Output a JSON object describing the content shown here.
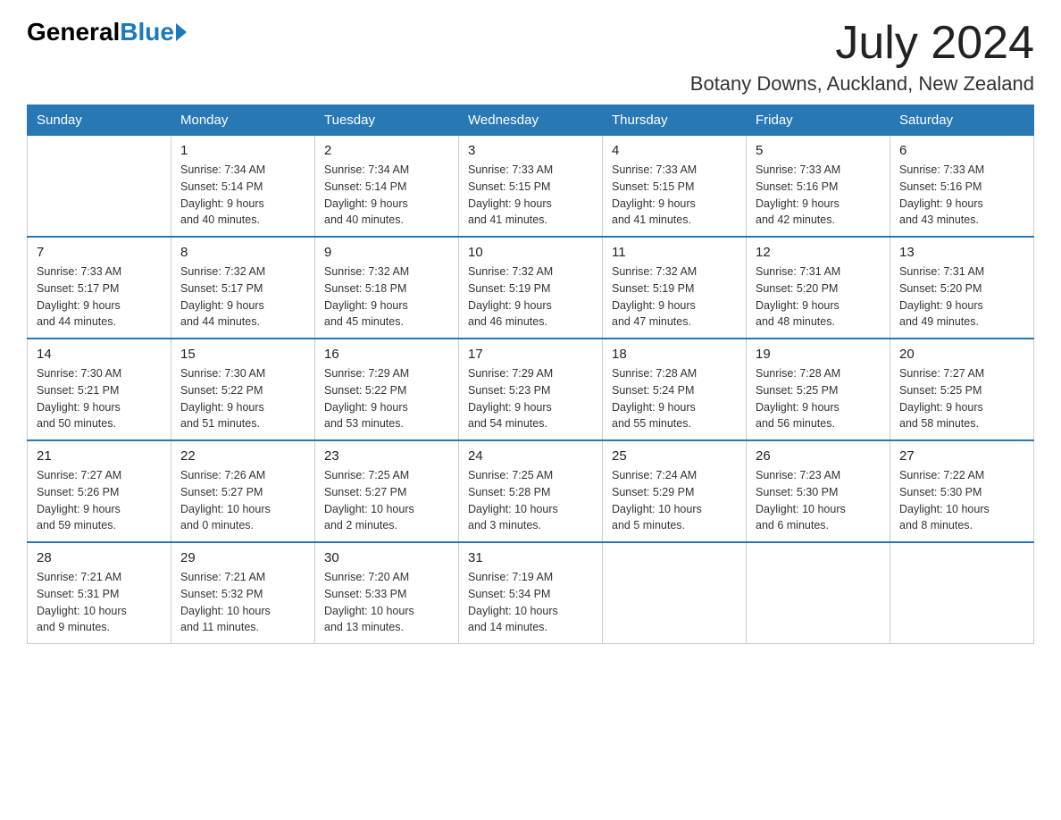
{
  "header": {
    "logo_general": "General",
    "logo_blue": "Blue",
    "month_year": "July 2024",
    "location": "Botany Downs, Auckland, New Zealand"
  },
  "weekdays": [
    "Sunday",
    "Monday",
    "Tuesday",
    "Wednesday",
    "Thursday",
    "Friday",
    "Saturday"
  ],
  "weeks": [
    [
      {
        "day": "",
        "info": ""
      },
      {
        "day": "1",
        "info": "Sunrise: 7:34 AM\nSunset: 5:14 PM\nDaylight: 9 hours\nand 40 minutes."
      },
      {
        "day": "2",
        "info": "Sunrise: 7:34 AM\nSunset: 5:14 PM\nDaylight: 9 hours\nand 40 minutes."
      },
      {
        "day": "3",
        "info": "Sunrise: 7:33 AM\nSunset: 5:15 PM\nDaylight: 9 hours\nand 41 minutes."
      },
      {
        "day": "4",
        "info": "Sunrise: 7:33 AM\nSunset: 5:15 PM\nDaylight: 9 hours\nand 41 minutes."
      },
      {
        "day": "5",
        "info": "Sunrise: 7:33 AM\nSunset: 5:16 PM\nDaylight: 9 hours\nand 42 minutes."
      },
      {
        "day": "6",
        "info": "Sunrise: 7:33 AM\nSunset: 5:16 PM\nDaylight: 9 hours\nand 43 minutes."
      }
    ],
    [
      {
        "day": "7",
        "info": "Sunrise: 7:33 AM\nSunset: 5:17 PM\nDaylight: 9 hours\nand 44 minutes."
      },
      {
        "day": "8",
        "info": "Sunrise: 7:32 AM\nSunset: 5:17 PM\nDaylight: 9 hours\nand 44 minutes."
      },
      {
        "day": "9",
        "info": "Sunrise: 7:32 AM\nSunset: 5:18 PM\nDaylight: 9 hours\nand 45 minutes."
      },
      {
        "day": "10",
        "info": "Sunrise: 7:32 AM\nSunset: 5:19 PM\nDaylight: 9 hours\nand 46 minutes."
      },
      {
        "day": "11",
        "info": "Sunrise: 7:32 AM\nSunset: 5:19 PM\nDaylight: 9 hours\nand 47 minutes."
      },
      {
        "day": "12",
        "info": "Sunrise: 7:31 AM\nSunset: 5:20 PM\nDaylight: 9 hours\nand 48 minutes."
      },
      {
        "day": "13",
        "info": "Sunrise: 7:31 AM\nSunset: 5:20 PM\nDaylight: 9 hours\nand 49 minutes."
      }
    ],
    [
      {
        "day": "14",
        "info": "Sunrise: 7:30 AM\nSunset: 5:21 PM\nDaylight: 9 hours\nand 50 minutes."
      },
      {
        "day": "15",
        "info": "Sunrise: 7:30 AM\nSunset: 5:22 PM\nDaylight: 9 hours\nand 51 minutes."
      },
      {
        "day": "16",
        "info": "Sunrise: 7:29 AM\nSunset: 5:22 PM\nDaylight: 9 hours\nand 53 minutes."
      },
      {
        "day": "17",
        "info": "Sunrise: 7:29 AM\nSunset: 5:23 PM\nDaylight: 9 hours\nand 54 minutes."
      },
      {
        "day": "18",
        "info": "Sunrise: 7:28 AM\nSunset: 5:24 PM\nDaylight: 9 hours\nand 55 minutes."
      },
      {
        "day": "19",
        "info": "Sunrise: 7:28 AM\nSunset: 5:25 PM\nDaylight: 9 hours\nand 56 minutes."
      },
      {
        "day": "20",
        "info": "Sunrise: 7:27 AM\nSunset: 5:25 PM\nDaylight: 9 hours\nand 58 minutes."
      }
    ],
    [
      {
        "day": "21",
        "info": "Sunrise: 7:27 AM\nSunset: 5:26 PM\nDaylight: 9 hours\nand 59 minutes."
      },
      {
        "day": "22",
        "info": "Sunrise: 7:26 AM\nSunset: 5:27 PM\nDaylight: 10 hours\nand 0 minutes."
      },
      {
        "day": "23",
        "info": "Sunrise: 7:25 AM\nSunset: 5:27 PM\nDaylight: 10 hours\nand 2 minutes."
      },
      {
        "day": "24",
        "info": "Sunrise: 7:25 AM\nSunset: 5:28 PM\nDaylight: 10 hours\nand 3 minutes."
      },
      {
        "day": "25",
        "info": "Sunrise: 7:24 AM\nSunset: 5:29 PM\nDaylight: 10 hours\nand 5 minutes."
      },
      {
        "day": "26",
        "info": "Sunrise: 7:23 AM\nSunset: 5:30 PM\nDaylight: 10 hours\nand 6 minutes."
      },
      {
        "day": "27",
        "info": "Sunrise: 7:22 AM\nSunset: 5:30 PM\nDaylight: 10 hours\nand 8 minutes."
      }
    ],
    [
      {
        "day": "28",
        "info": "Sunrise: 7:21 AM\nSunset: 5:31 PM\nDaylight: 10 hours\nand 9 minutes."
      },
      {
        "day": "29",
        "info": "Sunrise: 7:21 AM\nSunset: 5:32 PM\nDaylight: 10 hours\nand 11 minutes."
      },
      {
        "day": "30",
        "info": "Sunrise: 7:20 AM\nSunset: 5:33 PM\nDaylight: 10 hours\nand 13 minutes."
      },
      {
        "day": "31",
        "info": "Sunrise: 7:19 AM\nSunset: 5:34 PM\nDaylight: 10 hours\nand 14 minutes."
      },
      {
        "day": "",
        "info": ""
      },
      {
        "day": "",
        "info": ""
      },
      {
        "day": "",
        "info": ""
      }
    ]
  ]
}
